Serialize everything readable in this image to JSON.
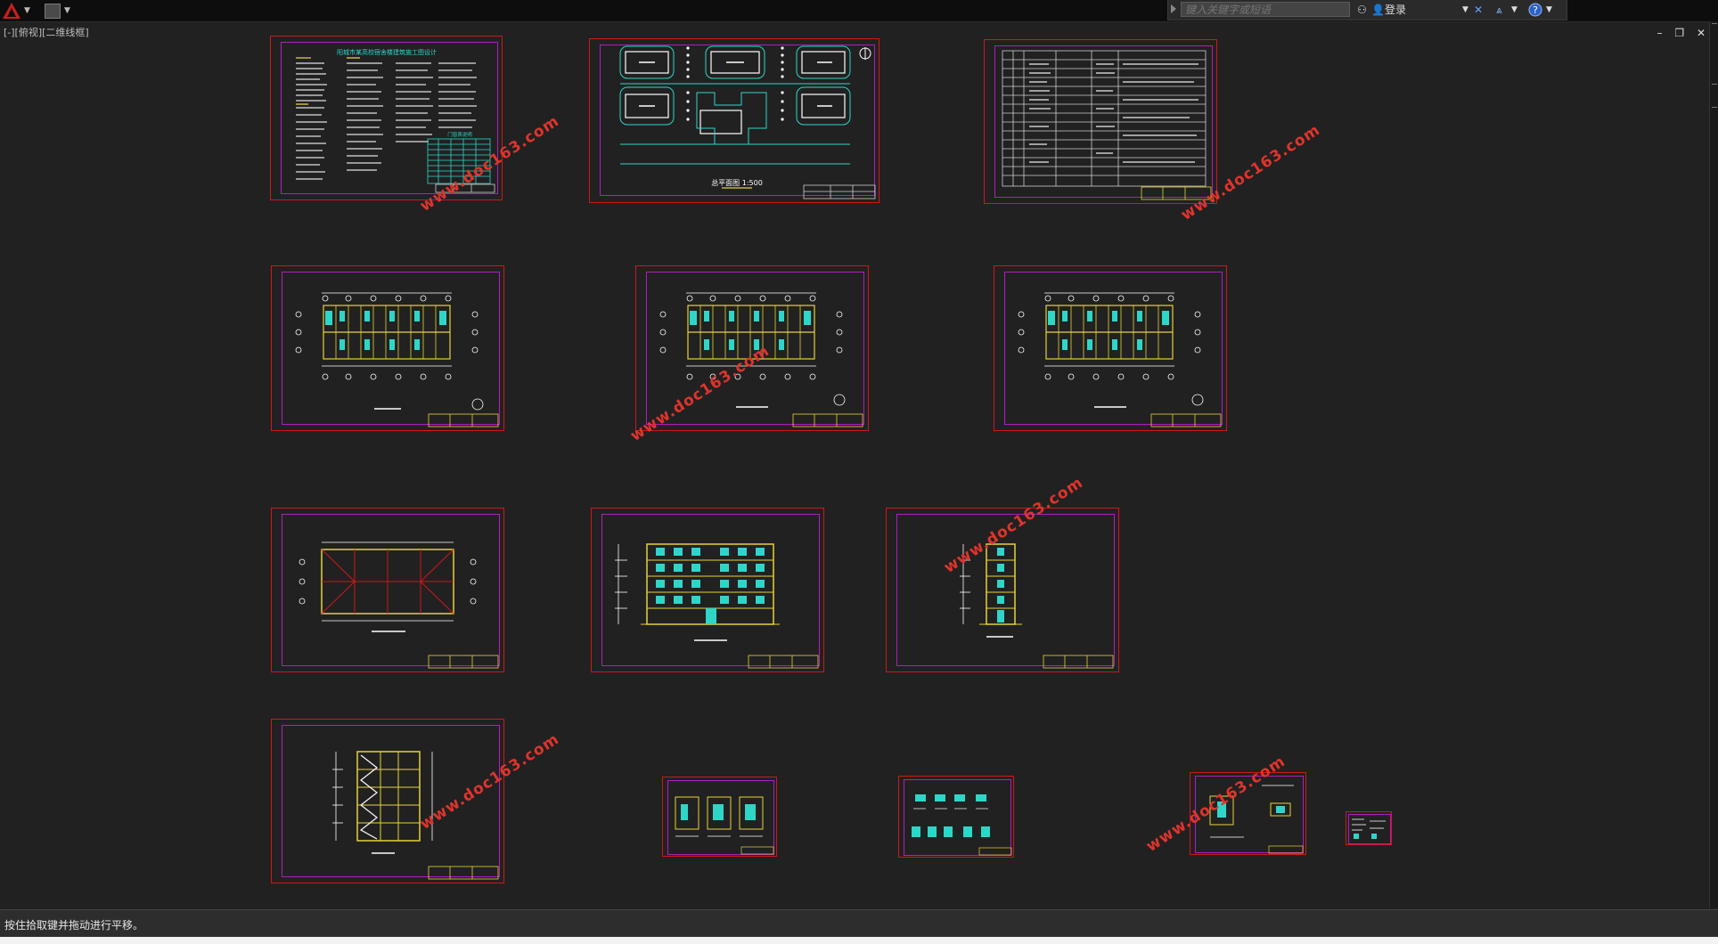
{
  "toolbar": {
    "search_placeholder": "键入关键字或短语",
    "login_label": "登录"
  },
  "viewport": {
    "label": "[-][俯视][二维线框]",
    "controls": [
      "–",
      "❐",
      "✕"
    ]
  },
  "sheets": {
    "design_notes_title": "阳城市某高校宿舍楼建筑施工图设计",
    "site_plan_caption": "总平面图 1:500",
    "door_window_table_title": "门窗表说明"
  },
  "watermark_text": "www.doc163.com",
  "status": {
    "message": "按住拾取键并拖动进行平移。"
  },
  "colors": {
    "background": "#212121",
    "sheet_border": "#d01818",
    "inner_frame": "#b01ec0",
    "drawing_yellow": "#e6d23a",
    "drawing_cyan": "#2fd6c8",
    "watermark": "#e0342c"
  }
}
